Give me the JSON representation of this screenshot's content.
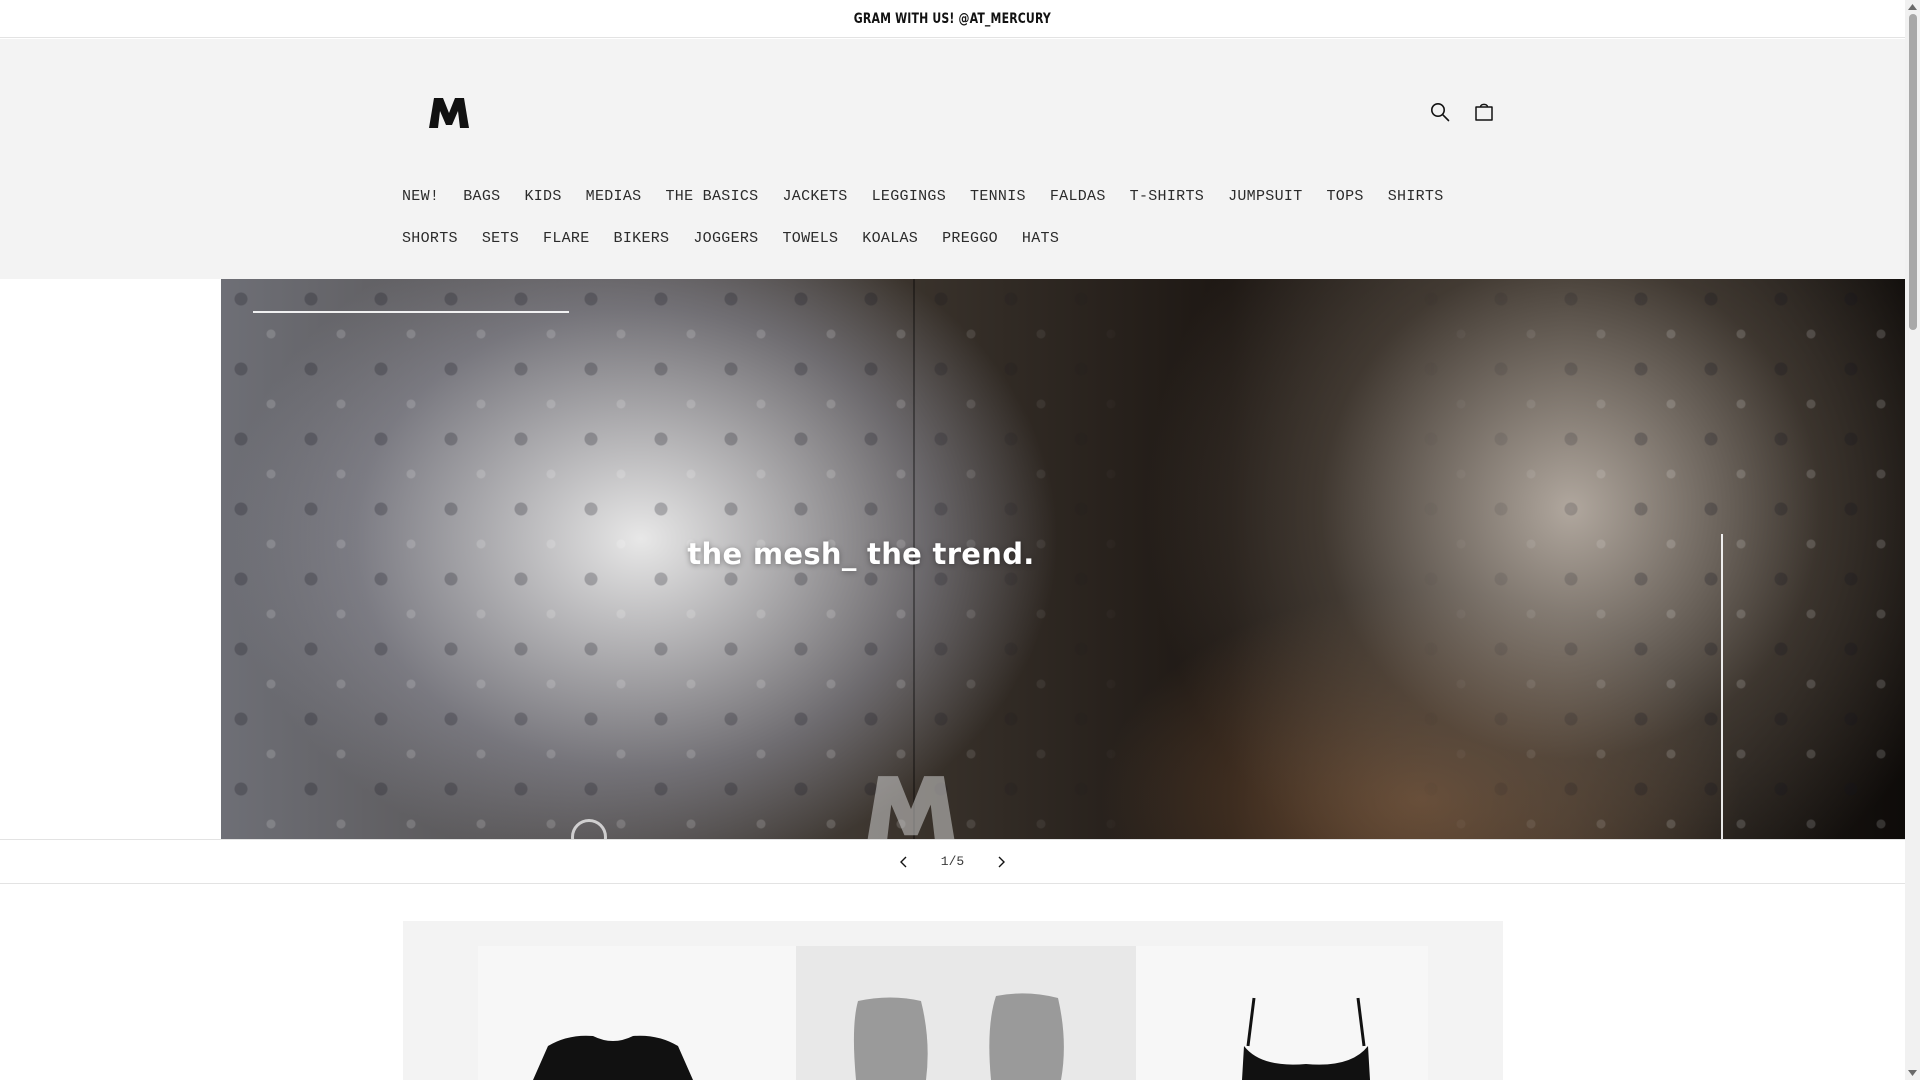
{
  "announcement": {
    "text": "GRAM WITH US! @AT_MERCURY"
  },
  "header": {
    "logo_text": "M",
    "search_icon": "search-icon",
    "cart_icon": "cart-icon"
  },
  "nav": {
    "row1": [
      "NEW!",
      "BAGS",
      "KIDS",
      "MEDIAS",
      "THE BASICS",
      "JACKETS",
      "LEGGINGS",
      "TENNIS",
      "FALDAS",
      "T-SHIRTS",
      "JUMPSUIT",
      "TOPS",
      "SHIRTS"
    ],
    "row2": [
      "SHORTS",
      "SETS",
      "FLARE",
      "BIKERS",
      "JOGGERS",
      "TOWELS",
      "KOALAS",
      "PREGGO",
      "HATS"
    ]
  },
  "hero": {
    "heading": "the  mesh_ the trend.",
    "watermark": "M"
  },
  "slider": {
    "counter": "1/5",
    "prev_icon": "chevron-left-icon",
    "next_icon": "chevron-right-icon"
  },
  "colors": {
    "header_bg": "#f3f3f3",
    "text": "#121212",
    "border": "#e3e3e3"
  }
}
